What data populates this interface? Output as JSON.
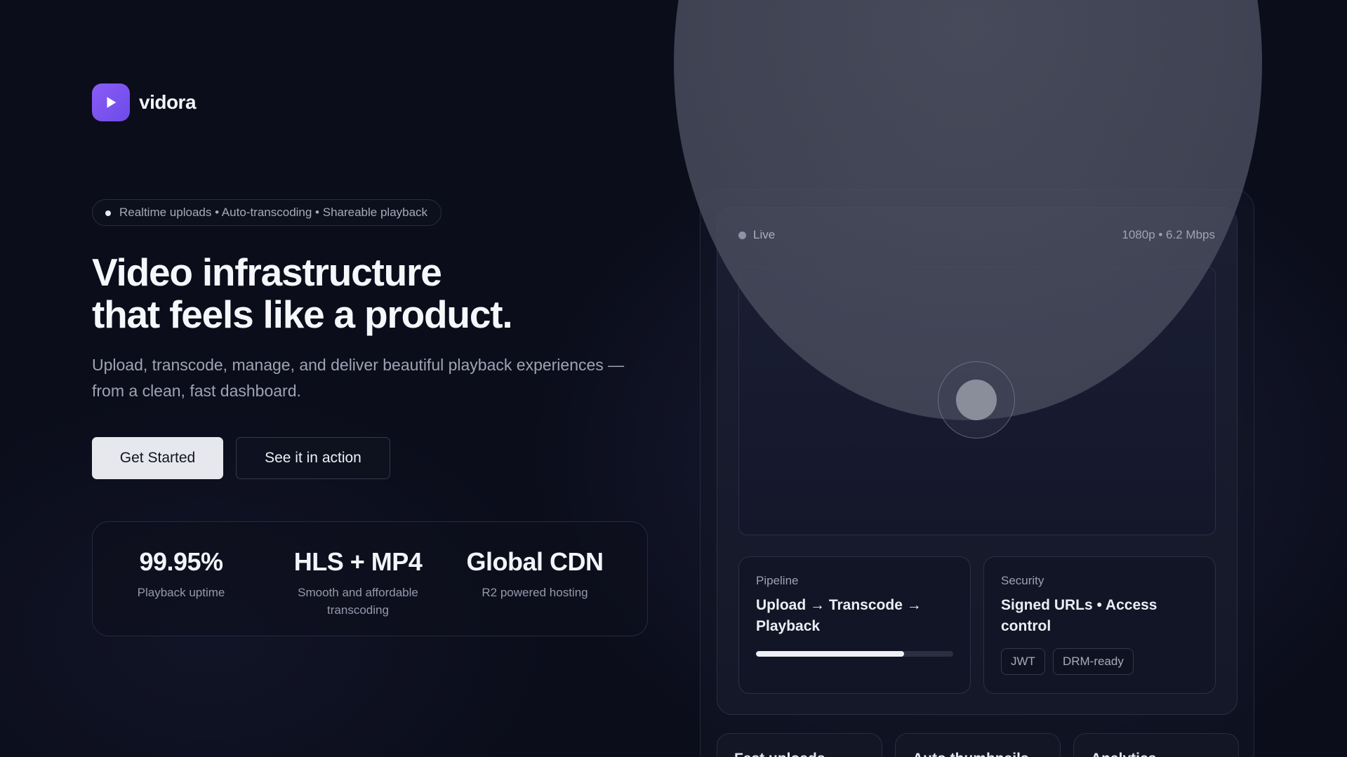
{
  "brand": {
    "name": "vidora",
    "accent": "#7c55f0"
  },
  "hero": {
    "tagline": "Realtime uploads • Auto-transcoding • Shareable playback",
    "headline_line1": "Video infrastructure",
    "headline_line2": "that feels like a product.",
    "subhead": "Upload, transcode, manage, and deliver beautiful playback experiences —from a clean, fast dashboard.",
    "primary_cta": "Get Started",
    "secondary_cta": "See it in action"
  },
  "stats": [
    {
      "value": "99.95%",
      "label": "Playback uptime"
    },
    {
      "value": "HLS + MP4",
      "label": "Smooth and affordable transcoding"
    },
    {
      "value": "Global CDN",
      "label": "R2 powered hosting"
    }
  ],
  "preview": {
    "status": "Live",
    "quality": "1080p • 6.2 Mbps",
    "play_icon": "play-icon",
    "pipeline": {
      "kicker": "Pipeline",
      "title": "Upload → Transcode → Playback",
      "progress": 0.75
    },
    "security": {
      "kicker": "Security",
      "title": "Signed URLs • Access control",
      "chips": [
        "JWT",
        "DRM-ready"
      ]
    },
    "features": [
      "Fast uploads",
      "Auto thumbnails",
      "Analytics"
    ]
  }
}
